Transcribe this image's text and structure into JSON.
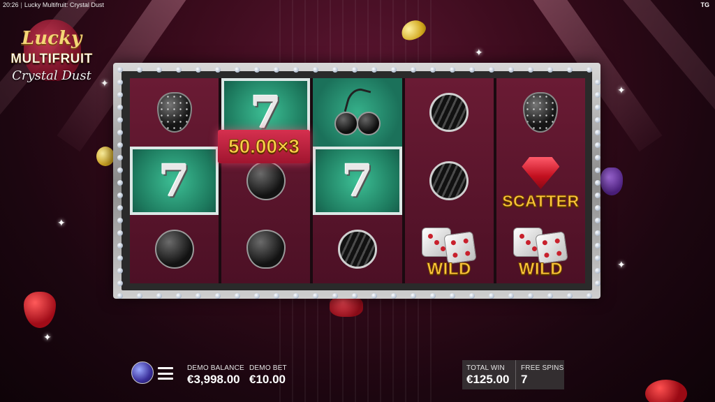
{
  "status": {
    "time": "20:26",
    "separator": "|",
    "game_title": "Lucky Multifruit: Crystal Dust",
    "provider_badge": "TG"
  },
  "logo": {
    "line1": "Lucky",
    "line2": "MULTIFRUIT",
    "line3": "Crystal Dust"
  },
  "reels": [
    [
      {
        "symbol": "strawberry-black"
      },
      {
        "symbol": "seven",
        "text": "7",
        "highlight": true
      },
      {
        "symbol": "plum-black"
      }
    ],
    [
      {
        "symbol": "seven",
        "text": "7",
        "highlight": true
      },
      {
        "symbol": "plum-black"
      },
      {
        "symbol": "lemon-black"
      }
    ],
    [
      {
        "symbol": "cherries-black",
        "bg": "teal"
      },
      {
        "symbol": "seven",
        "text": "7",
        "highlight": true
      },
      {
        "symbol": "watermelon-black"
      }
    ],
    [
      {
        "symbol": "watermelon-black"
      },
      {
        "symbol": "watermelon-black"
      },
      {
        "symbol": "wild-dice",
        "text": "WILD"
      }
    ],
    [
      {
        "symbol": "strawberry-black"
      },
      {
        "symbol": "scatter-gem",
        "text": "SCATTER"
      },
      {
        "symbol": "wild-dice",
        "text": "WILD"
      }
    ]
  ],
  "win_badge": "50.00×3",
  "hud": {
    "balance_label": "DEMO BALANCE",
    "balance_value": "€3,998.00",
    "bet_label": "DEMO BET",
    "bet_value": "€10.00",
    "total_win_label": "TOTAL WIN",
    "total_win_value": "€125.00",
    "free_spins_label": "FREE SPINS",
    "free_spins_value": "7"
  },
  "colors": {
    "accent_gold": "#ffc83d",
    "win_badge_red": "#d6304f",
    "teal": "#2a9a78",
    "bg_wine": "#3a0b1c"
  }
}
